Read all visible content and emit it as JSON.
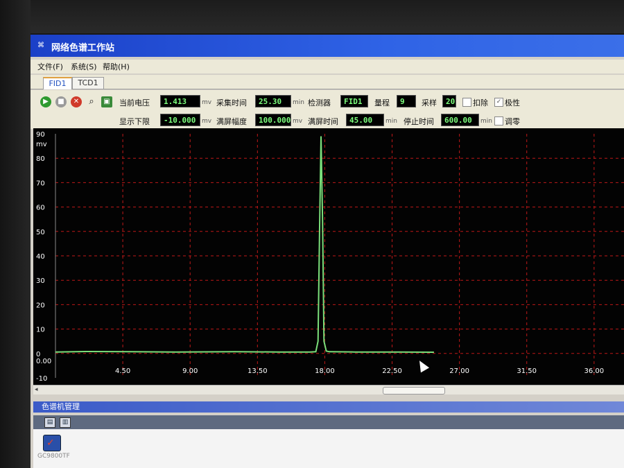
{
  "window": {
    "title": "网络色谱工作站",
    "icon": "app-icon"
  },
  "menu": [
    "文件(F)",
    "系统(S)",
    "帮助(H)"
  ],
  "tabs": [
    {
      "label": "FID1",
      "active": true
    },
    {
      "label": "TCD1",
      "active": false
    }
  ],
  "toolbar": {
    "buttons": [
      "play-icon",
      "stop-icon",
      "cancel-icon",
      "zoom-icon",
      "save-icon"
    ],
    "current_voltage": {
      "label": "当前电压",
      "value": "1.413",
      "unit": "mv"
    },
    "acq_time": {
      "label": "采集时间",
      "value": "25.30",
      "unit": "min"
    },
    "detector": {
      "label": "检测器",
      "value": "FID1"
    },
    "range": {
      "label": "量程",
      "value": "9"
    },
    "sample": {
      "label": "采样",
      "value": "20"
    },
    "deduct": {
      "label": "扣除",
      "checked": false
    },
    "polarity": {
      "label": "极性",
      "checked": true
    },
    "display_lower": {
      "label": "显示下限",
      "value": "-10.000",
      "unit": "mv"
    },
    "full_amplitude": {
      "label": "满屏幅度",
      "value": "100.000",
      "unit": "mv"
    },
    "full_time": {
      "label": "满屏时间",
      "value": "45.00",
      "unit": "min"
    },
    "stop_time": {
      "label": "停止时间",
      "value": "600.00",
      "unit": "min"
    },
    "zero": {
      "label": "调零",
      "checked": false
    }
  },
  "chart_data": {
    "type": "line",
    "ylabel": "mv",
    "ylim": [
      -10,
      90
    ],
    "xlim": [
      0,
      38
    ],
    "x_ticks": [
      "0.00",
      "4.50",
      "9.00",
      "13.50",
      "18.00",
      "22.50",
      "27.00",
      "31.50",
      "36.00"
    ],
    "x_tick_values": [
      0,
      4.5,
      9,
      13.5,
      18,
      22.5,
      27,
      31.5,
      36
    ],
    "y_ticks": [
      "90",
      "80",
      "70",
      "60",
      "50",
      "40",
      "30",
      "20",
      "10",
      "0",
      "-10"
    ],
    "y_tick_values": [
      90,
      80,
      70,
      60,
      50,
      40,
      30,
      20,
      10,
      0,
      -10
    ],
    "grid": true,
    "colors": {
      "background": "#030303",
      "grid": "#c01818",
      "line": "#7be07b",
      "axis_text": "#ffffff"
    },
    "series": [
      {
        "x": [
          0,
          2,
          5,
          8,
          12,
          15,
          17,
          17.4,
          17.55,
          17.65,
          17.75,
          17.85,
          17.95,
          18.1,
          18.3,
          20,
          23,
          25.3
        ],
        "y": [
          0.6,
          0.8,
          0.7,
          0.6,
          0.7,
          0.6,
          0.6,
          0.7,
          5,
          50,
          89,
          55,
          5,
          1,
          0.7,
          0.6,
          0.6,
          0.5
        ]
      }
    ]
  },
  "scrollbar": {
    "left_arrow": "◂"
  },
  "panel": {
    "title": "色谱机管理",
    "buttons": [
      "monitor-icon",
      "folder-icon"
    ],
    "instrument": {
      "label": "GC9800TF"
    }
  },
  "cursor": "mouse-pointer-icon"
}
